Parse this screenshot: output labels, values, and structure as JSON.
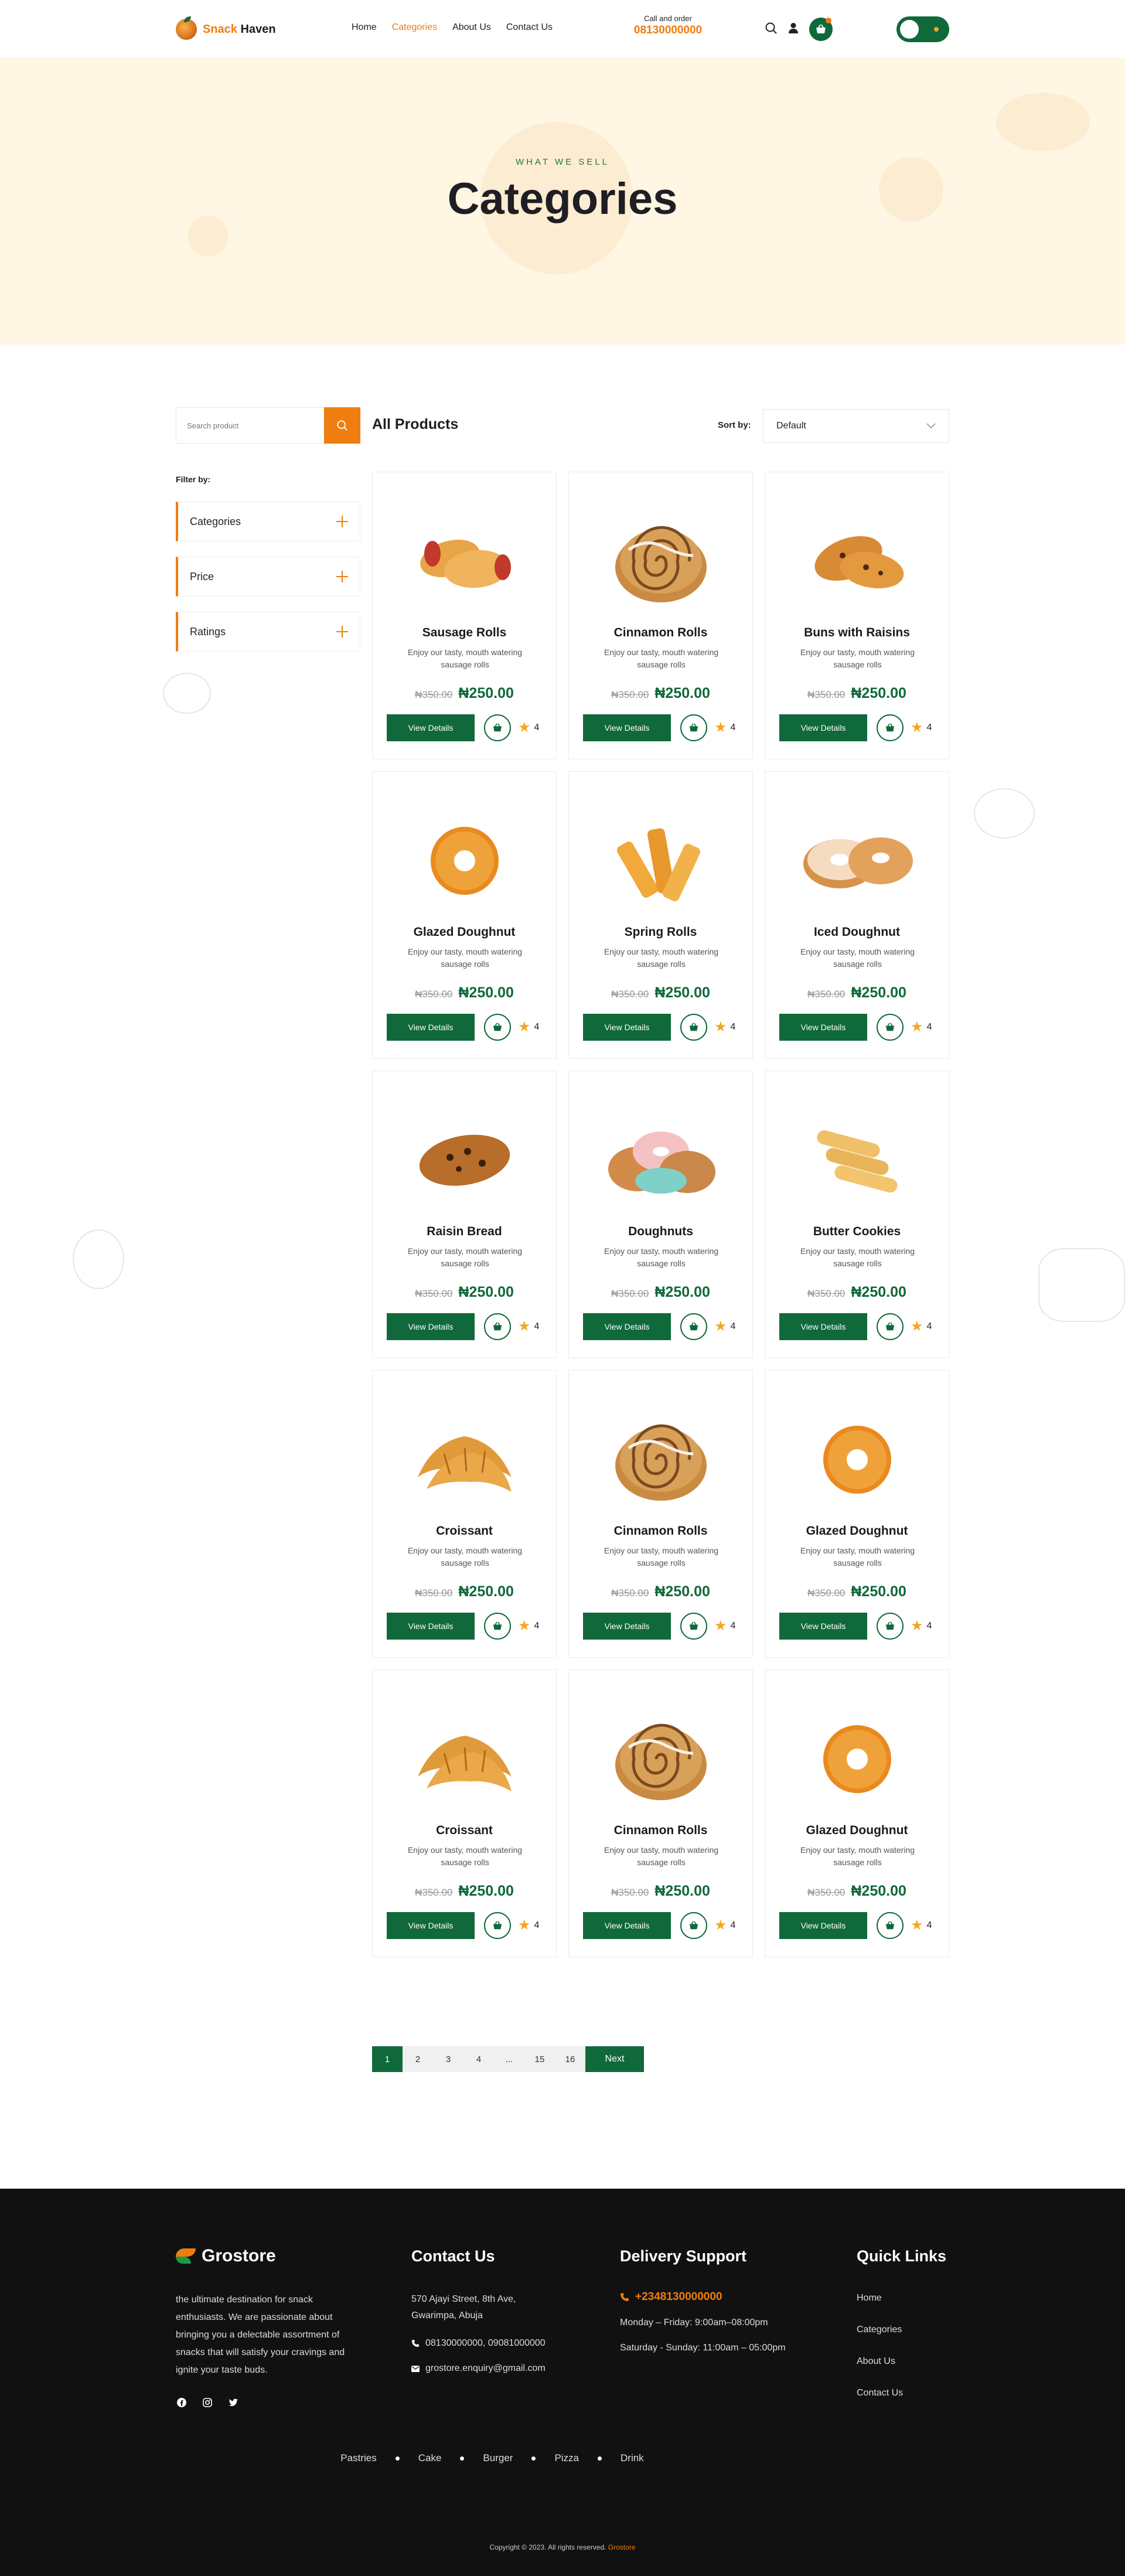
{
  "header": {
    "brand_first": "Snack",
    "brand_second": "Haven",
    "nav": [
      "Home",
      "Categories",
      "About Us",
      "Contact Us"
    ],
    "call_label": "Call and order",
    "call_number": "08130000000",
    "accent": "#f07d10",
    "primary": "#10693a"
  },
  "hero": {
    "subtitle": "WHAT WE SELL",
    "title": "Categories"
  },
  "sidebar": {
    "search_placeholder": "Search product",
    "filter_label": "Filter by:",
    "filters": [
      "Categories",
      "Price",
      "Ratings"
    ]
  },
  "products_bar": {
    "title": "All Products",
    "sort_label": "Sort by:",
    "sort_value": "Default"
  },
  "products": [
    {
      "name": "Sausage Rolls",
      "desc": "Enjoy our tasty, mouth watering sausage rolls",
      "old_price": "₦350.00",
      "price": "₦250.00",
      "rating": "4",
      "icon": "sausage-roll"
    },
    {
      "name": "Cinnamon Rolls",
      "desc": "Enjoy our tasty, mouth watering sausage rolls",
      "old_price": "₦350.00",
      "price": "₦250.00",
      "rating": "4",
      "icon": "cinnamon-roll"
    },
    {
      "name": "Buns with Raisins",
      "desc": "Enjoy our tasty, mouth watering sausage rolls",
      "old_price": "₦350.00",
      "price": "₦250.00",
      "rating": "4",
      "icon": "raisin-bun"
    },
    {
      "name": "Glazed Doughnut",
      "desc": "Enjoy our tasty, mouth watering sausage rolls",
      "old_price": "₦350.00",
      "price": "₦250.00",
      "rating": "4",
      "icon": "glazed-doughnut"
    },
    {
      "name": "Spring Rolls",
      "desc": "Enjoy our tasty, mouth watering sausage rolls",
      "old_price": "₦350.00",
      "price": "₦250.00",
      "rating": "4",
      "icon": "spring-roll"
    },
    {
      "name": "Iced Doughnut",
      "desc": "Enjoy our tasty, mouth watering sausage rolls",
      "old_price": "₦350.00",
      "price": "₦250.00",
      "rating": "4",
      "icon": "iced-doughnut"
    },
    {
      "name": "Raisin Bread",
      "desc": "Enjoy our tasty, mouth watering sausage rolls",
      "old_price": "₦350.00",
      "price": "₦250.00",
      "rating": "4",
      "icon": "raisin-bread"
    },
    {
      "name": "Doughnuts",
      "desc": "Enjoy our tasty, mouth watering sausage rolls",
      "old_price": "₦350.00",
      "price": "₦250.00",
      "rating": "4",
      "icon": "doughnut-stack"
    },
    {
      "name": "Butter Cookies",
      "desc": "Enjoy our tasty, mouth watering sausage rolls",
      "old_price": "₦350.00",
      "price": "₦250.00",
      "rating": "4",
      "icon": "butter-cookie"
    },
    {
      "name": "Croissant",
      "desc": "Enjoy our tasty, mouth watering sausage rolls",
      "old_price": "₦350.00",
      "price": "₦250.00",
      "rating": "4",
      "icon": "croissant"
    },
    {
      "name": "Cinnamon Rolls",
      "desc": "Enjoy our tasty, mouth watering sausage rolls",
      "old_price": "₦350.00",
      "price": "₦250.00",
      "rating": "4",
      "icon": "cinnamon-roll"
    },
    {
      "name": "Glazed Doughnut",
      "desc": "Enjoy our tasty, mouth watering sausage rolls",
      "old_price": "₦350.00",
      "price": "₦250.00",
      "rating": "4",
      "icon": "glazed-doughnut"
    },
    {
      "name": "Croissant",
      "desc": "Enjoy our tasty, mouth watering sausage rolls",
      "old_price": "₦350.00",
      "price": "₦250.00",
      "rating": "4",
      "icon": "croissant"
    },
    {
      "name": "Cinnamon Rolls",
      "desc": "Enjoy our tasty, mouth watering sausage rolls",
      "old_price": "₦350.00",
      "price": "₦250.00",
      "rating": "4",
      "icon": "cinnamon-roll"
    },
    {
      "name": "Glazed Doughnut",
      "desc": "Enjoy our tasty, mouth watering sausage rolls",
      "old_price": "₦350.00",
      "price": "₦250.00",
      "rating": "4",
      "icon": "glazed-doughnut"
    }
  ],
  "view_details_label": "View Details",
  "pagination": {
    "pages": [
      "1",
      "2",
      "3",
      "4",
      "...",
      "15",
      "16"
    ],
    "next_label": "Next"
  },
  "footer": {
    "brand": "Grostore",
    "about": "the ultimate destination for snack enthusiasts. We are passionate about bringing you a delectable assortment of snacks that will satisfy your cravings and ignite your taste buds.",
    "contact_title": "Contact Us",
    "address": "570 Ajayi Street, 8th Ave, Gwarimpa, Abuja",
    "phones": "08130000000,  09081000000",
    "email": "grostore.enquiry@gmail.com",
    "delivery_title": "Delivery Support",
    "delivery_phone": "+2348130000000",
    "hours_weekday": "Monday – Friday: 9:00am–08:00pm",
    "hours_weekend": "Saturday - Sunday: 11:00am – 05:00pm",
    "links_title": "Quick Links",
    "links": [
      "Home",
      "Categories",
      "About Us",
      "Contact Us"
    ],
    "categories": [
      "Pastries",
      "Cake",
      "Burger",
      "Pizza",
      "Drink"
    ],
    "copyright": "Copyright © 2023. All rights reserved.",
    "copyright_brand": "Grostore"
  }
}
